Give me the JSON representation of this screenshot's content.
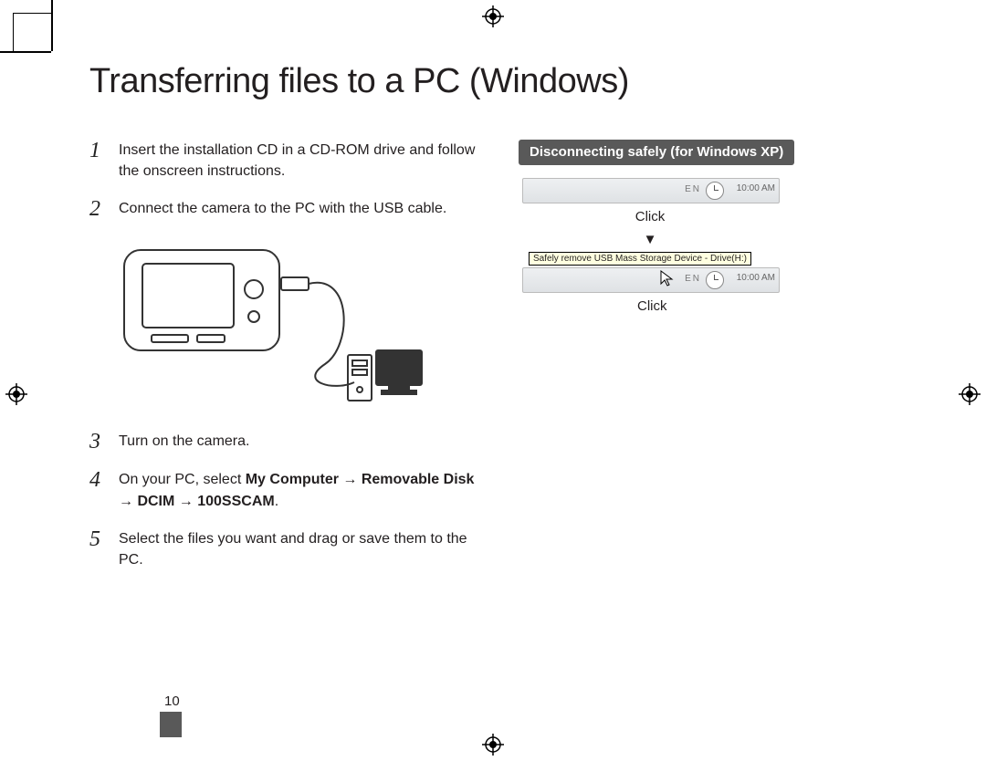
{
  "page": {
    "title": "Transferring files to a PC (Windows)",
    "number": "10"
  },
  "steps": [
    {
      "n": "1",
      "text": "Insert the installation CD in a CD-ROM drive and follow the onscreen instructions."
    },
    {
      "n": "2",
      "text": "Connect the camera to the PC with the USB cable."
    },
    {
      "n": "3",
      "text": "Turn on the camera."
    },
    {
      "n": "4",
      "pre": "On your PC, select ",
      "bold": "My Computer → Removable Disk → DCIM → 100SSCAM",
      "post": "."
    },
    {
      "n": "5",
      "text": "Select the files you want and drag or save them to the PC."
    }
  ],
  "right": {
    "panel_title": "Disconnecting safely (for Windows XP)",
    "click1": "Click",
    "arrow": "▼",
    "tooltip": "Safely remove USB Mass Storage Device - Drive(H:)",
    "click2": "Click",
    "time": "10:00 AM",
    "lang": "EN"
  }
}
